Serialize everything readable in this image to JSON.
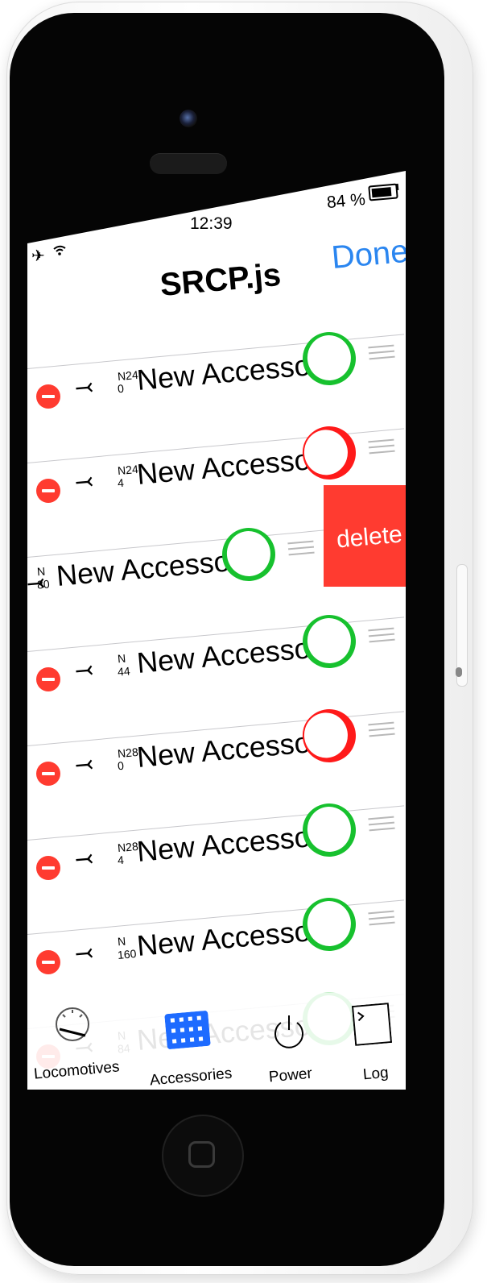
{
  "status": {
    "time": "12:39",
    "battery_pct": "84 %",
    "battery_level": 0.84,
    "airplane_icon": "airplane-icon",
    "wifi_icon": "wifi-icon"
  },
  "nav": {
    "title": "SRCP.js",
    "done_label": "Done"
  },
  "rows": [
    {
      "addr_a": "N24",
      "addr_b": "0",
      "name": "New Accessory",
      "state": "on"
    },
    {
      "addr_a": "N24",
      "addr_b": "4",
      "name": "New Accessory",
      "state": "off"
    },
    {
      "addr_a": "N",
      "addr_b": "80",
      "name": "New Accessory",
      "state": "on"
    },
    {
      "addr_a": "N",
      "addr_b": "44",
      "name": "New Accessory",
      "state": "on"
    },
    {
      "addr_a": "N28",
      "addr_b": "0",
      "name": "New Accessory",
      "state": "off"
    },
    {
      "addr_a": "N28",
      "addr_b": "4",
      "name": "New Accessory",
      "state": "on"
    },
    {
      "addr_a": "N",
      "addr_b": "160",
      "name": "New Accessory",
      "state": "on"
    },
    {
      "addr_a": "N",
      "addr_b": "84",
      "name": "New Accessory",
      "state": "on"
    }
  ],
  "delete_label": "delete",
  "tabs": [
    {
      "label": "Locomotives",
      "icon": "speedometer-icon",
      "selected": false
    },
    {
      "label": "Accessories",
      "icon": "accessories-grid-icon",
      "selected": true
    },
    {
      "label": "Power",
      "icon": "power-icon",
      "selected": false
    },
    {
      "label": "Log",
      "icon": "terminal-icon",
      "selected": false
    }
  ],
  "colors": {
    "accent": "#2b86f0",
    "toggle_on": "#17c12e",
    "toggle_off": "#ff1a1a",
    "delete": "#ff3b30"
  }
}
